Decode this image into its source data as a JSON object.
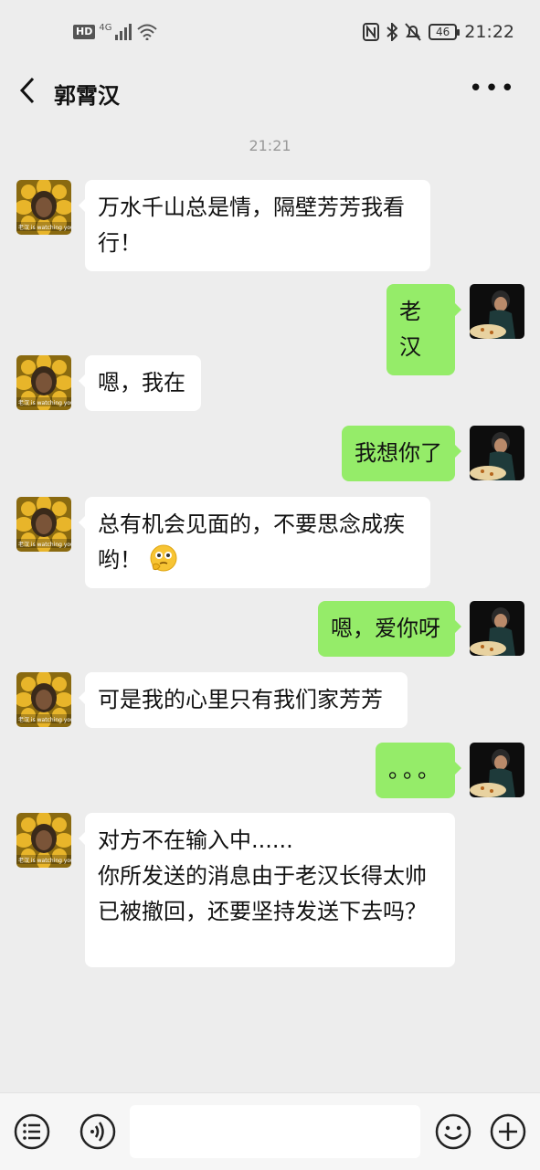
{
  "status_bar": {
    "hd": "HD",
    "network": "4G",
    "battery": "46",
    "time": "21:22"
  },
  "header": {
    "title": "郭霄汉"
  },
  "chat": {
    "timestamp": "21:21",
    "avatar_caption": "老汉 is watching you",
    "messages": [
      {
        "sender": "contact",
        "text": "万水千山总是情，隔壁芳芳我看行！"
      },
      {
        "sender": "me",
        "text": "老汉"
      },
      {
        "sender": "contact",
        "text": "嗯，我在"
      },
      {
        "sender": "me",
        "text": "我想你了"
      },
      {
        "sender": "contact",
        "text": "总有机会见面的，不要思念成疾哟！",
        "emoji": "thinking-face"
      },
      {
        "sender": "me",
        "text": "嗯，爱你呀"
      },
      {
        "sender": "contact",
        "text": "可是我的心里只有我们家芳芳"
      },
      {
        "sender": "me",
        "text": "。。。"
      },
      {
        "sender": "contact",
        "text": "对方不在输入中......\n你所发送的消息由于老汉长得太帅已被撤回，还要坚持发送下去吗？"
      }
    ]
  },
  "colors": {
    "background": "#ededed",
    "out_bubble": "#95ec69",
    "in_bubble": "#ffffff"
  }
}
